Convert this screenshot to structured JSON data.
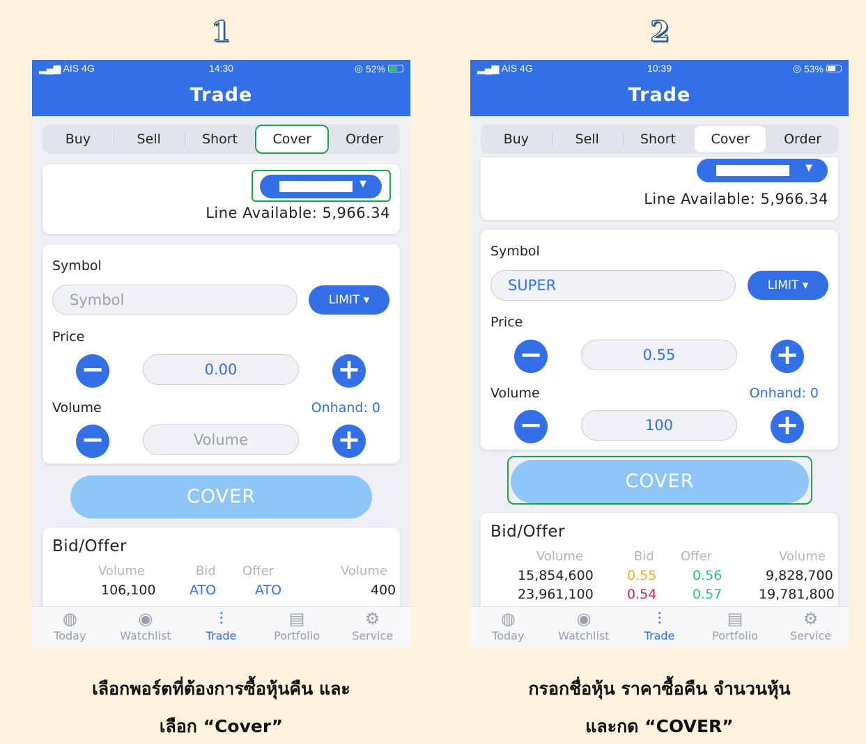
{
  "steps": [
    "1",
    "2"
  ],
  "panel1": {
    "status": {
      "carrier": "AIS 4G",
      "time": "14:30",
      "battery": "52%"
    },
    "title": "Trade",
    "tabs": [
      "Buy",
      "Sell",
      "Short",
      "Cover",
      "Order"
    ],
    "selected_tab": "Cover",
    "line_available": "Line Available: 5,966.34",
    "symbol_label": "Symbol",
    "symbol_placeholder": "Symbol",
    "order_type": "LIMIT ▾",
    "price_label": "Price",
    "price_value": "0.00",
    "volume_label": "Volume",
    "volume_placeholder": "Volume",
    "onhand": "Onhand: 0",
    "cover_button": "COVER",
    "bidoffer": {
      "title": "Bid/Offer",
      "headers": [
        "Volume",
        "Bid",
        "Offer",
        "Volume"
      ],
      "rows": [
        [
          "106,100",
          "ATO",
          "ATO",
          "400"
        ]
      ]
    },
    "caption_line1": "เลือกพอร์ตที่ต้องการซื้อหุ้นคืน และ",
    "caption_line2": "เลือก “Cover”"
  },
  "panel2": {
    "status": {
      "carrier": "AIS 4G",
      "time": "10:39",
      "battery": "53%"
    },
    "title": "Trade",
    "tabs": [
      "Buy",
      "Sell",
      "Short",
      "Cover",
      "Order"
    ],
    "selected_tab": "Cover",
    "line_available": "Line Available: 5,966.34",
    "symbol_label": "Symbol",
    "symbol_value": "SUPER",
    "order_type": "LIMIT ▾",
    "price_label": "Price",
    "price_value": "0.55",
    "volume_label": "Volume",
    "volume_value": "100",
    "onhand": "Onhand: 0",
    "cover_button": "COVER",
    "bidoffer": {
      "title": "Bid/Offer",
      "headers": [
        "Volume",
        "Bid",
        "Offer",
        "Volume"
      ],
      "rows": [
        [
          "15,854,600",
          "0.55",
          "0.56",
          "9,828,700"
        ],
        [
          "23,961,100",
          "0.54",
          "0.57",
          "19,781,800"
        ]
      ]
    },
    "caption_line1": "กรอกชื่อหุ้น ราคาซื้อคืน จำนวนหุ้น",
    "caption_line2": "และกด “COVER”"
  },
  "nav": [
    "Today",
    "Watchlist",
    "Trade",
    "Portfolio",
    "Service"
  ],
  "nav_icons": [
    "globe-icon",
    "eye-icon",
    "trade-sliders-icon",
    "portfolio-icon",
    "gear-icon"
  ],
  "colors": {
    "primary": "#3370e8",
    "highlight": "#1aa54a",
    "cover_button": "#8ec7f7",
    "bid_yellow": "#e0b52a",
    "bid_red": "#d6224a",
    "offer_green": "#2fbf8f",
    "ato_blue": "#3370e8"
  }
}
